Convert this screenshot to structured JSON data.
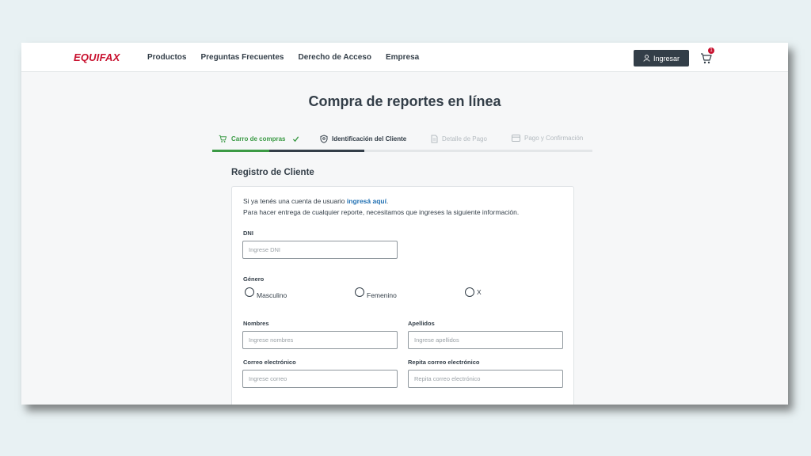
{
  "header": {
    "logo": "EQUIFAX",
    "nav": [
      "Productos",
      "Preguntas Frecuentes",
      "Derecho de Acceso",
      "Empresa"
    ],
    "login_label": "Ingresar",
    "cart_count": "1"
  },
  "page_title": "Compra de reportes en línea",
  "steps": [
    {
      "label": "Carro de compras",
      "state": "done"
    },
    {
      "label": "Identificación del Cliente",
      "state": "active"
    },
    {
      "label": "Detalle de Pago",
      "state": "pending"
    },
    {
      "label": "Pago y Confirmación",
      "state": "pending"
    }
  ],
  "form": {
    "section_title": "Registro de Cliente",
    "intro_line1_prefix": "Si ya tenés una cuenta de usuario ",
    "intro_link": "ingresá aquí",
    "intro_line1_suffix": ".",
    "intro_line2": "Para hacer entrega de cualquier reporte, necesitamos que ingreses la siguiente información.",
    "dni_label": "DNI",
    "dni_placeholder": "Ingrese DNI",
    "gender_label": "Género",
    "gender_options": [
      "Masculino",
      "Femenino",
      "X"
    ],
    "names_label": "Nombres",
    "names_placeholder": "Ingrese nombres",
    "surnames_label": "Apellidos",
    "surnames_placeholder": "Ingrese apellidos",
    "email_label": "Correo electrónico",
    "email_placeholder": "Ingrese correo",
    "email_repeat_label": "Repita correo electrónico",
    "email_repeat_placeholder": "Repita correo electrónico"
  },
  "colors": {
    "brand_red": "#c8102e",
    "dark": "#333e48",
    "success_green": "#3b9a45",
    "link_blue": "#1f6fb2"
  }
}
